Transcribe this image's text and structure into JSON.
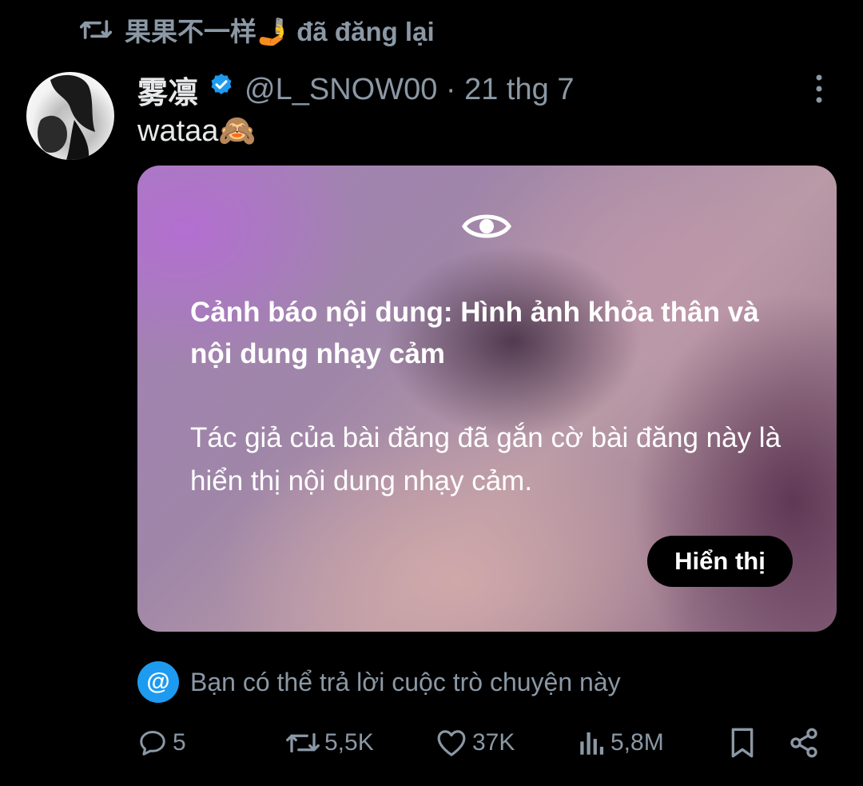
{
  "repost": {
    "text": "果果不一样🤳 đã đăng lại",
    "icon": "repost-icon"
  },
  "post": {
    "author_name": "雾凛",
    "verified_icon": "verified-badge-icon",
    "handle_date": "@L_SNOW00 · 21 thg 7",
    "text": "wataa🙈",
    "more_icon": "more-vertical-icon"
  },
  "media_warning": {
    "icon": "eye-icon",
    "title": "Cảnh báo nội dung: Hình ảnh khỏa thân và nội dung nhạy cảm",
    "body": "Tác giả của bài đăng đã gắn cờ bài đăng này là hiển thị nội dung nhạy cảm.",
    "button_label": "Hiển thị"
  },
  "reply_notice": {
    "icon_glyph": "@",
    "text": "Bạn có thể trả lời cuộc trò chuyện này"
  },
  "actions": {
    "replies": "5",
    "reposts": "5,5K",
    "likes": "37K",
    "views": "5,8M"
  },
  "colors": {
    "background": "#000000",
    "primary_text": "#e7e9ea",
    "secondary_text": "#8b98a5",
    "accent": "#1d9bf0"
  }
}
